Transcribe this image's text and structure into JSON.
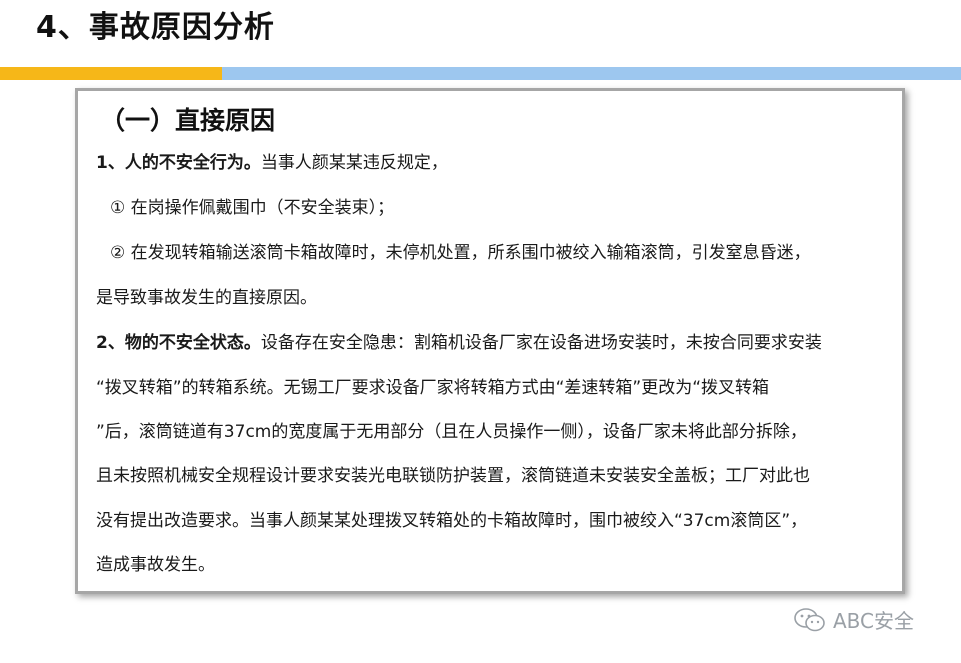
{
  "page": {
    "title": "4、事故原因分析"
  },
  "card": {
    "heading": "（一）直接原因",
    "section1": {
      "label": "1、人的不安全行为。",
      "text": "当事人颜某某违反规定，",
      "items": [
        "① 在岗操作佩戴围巾（不安全装束）；",
        "② 在发现转箱输送滚筒卡箱故障时，未停机处置，所系围巾被绞入输箱滚筒，引发窒息昏迷，"
      ],
      "conclusion": "是导致事故发生的直接原因。"
    },
    "section2": {
      "label": "2、物的不安全状态。",
      "lines": [
        "设备存在安全隐患：割箱机设备厂家在设备进场安装时，未按合同要求安装",
        "“拨叉转箱”的转箱系统。无锡工厂要求设备厂家将转箱方式由“差速转箱”更改为“拨叉转箱",
        "”后，滚筒链道有37cm的宽度属于无用部分（且在人员操作一侧），设备厂家未将此部分拆除，",
        "且未按照机械安全规程设计要求安装光电联锁防护装置，滚筒链道未安装安全盖板；工厂对此也",
        "没有提出改造要求。当事人颜某某处理拨叉转箱处的卡箱故障时，围巾被绞入“37cm滚筒区”，",
        "造成事故发生。"
      ]
    }
  },
  "watermark": {
    "icon": "wechat-icon",
    "text": "ABC安全"
  },
  "colors": {
    "accent_yellow": "#f6b718",
    "accent_blue": "#9dc7ef",
    "card_border": "#a6a6a6"
  }
}
